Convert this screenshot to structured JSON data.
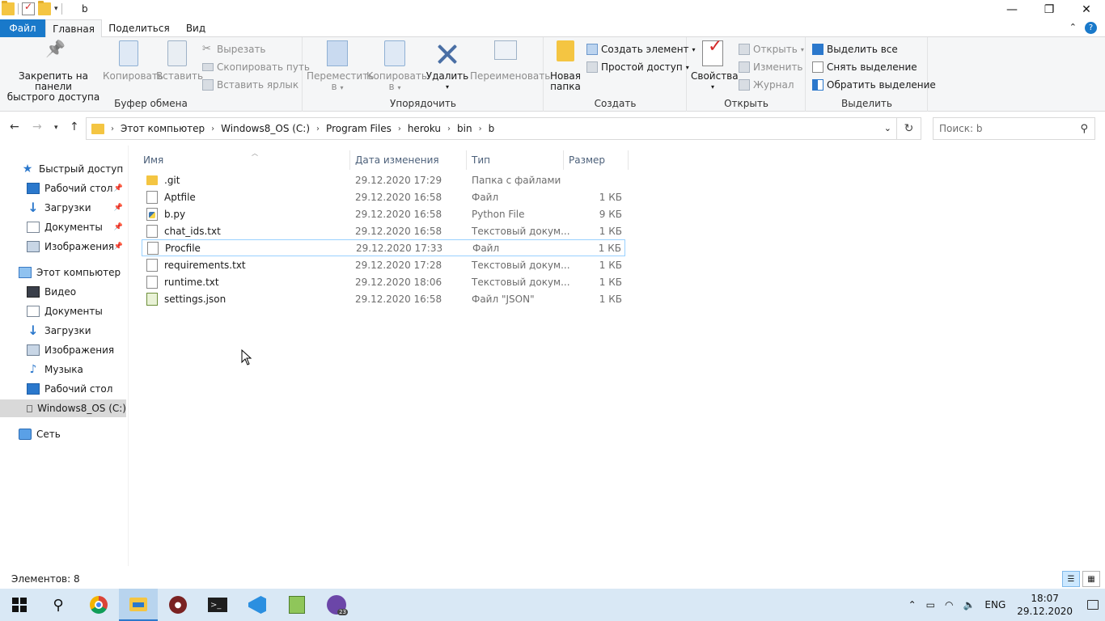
{
  "window": {
    "title": "b"
  },
  "window_controls": {
    "minimize": "—",
    "maximize": "❐",
    "close": "✕"
  },
  "ribbon_tabs": {
    "file": "Файл",
    "home": "Главная",
    "share": "Поделиться",
    "view": "Вид"
  },
  "ribbon": {
    "clipboard": {
      "label": "Буфер обмена",
      "pin_line1": "Закрепить на панели",
      "pin_line2": "быстрого доступа",
      "copy": "Копировать",
      "paste": "Вставить",
      "cut": "Вырезать",
      "copy_path": "Скопировать путь",
      "paste_shortcut": "Вставить ярлык"
    },
    "organize": {
      "label": "Упорядочить",
      "move_line1": "Переместить",
      "move_line2": "в",
      "copyto_line1": "Копировать",
      "copyto_line2": "в",
      "delete": "Удалить",
      "rename": "Переименовать"
    },
    "new": {
      "label": "Создать",
      "new_folder_line1": "Новая",
      "new_folder_line2": "папка",
      "new_item": "Создать элемент",
      "easy_access": "Простой доступ"
    },
    "open": {
      "label": "Открыть",
      "properties": "Свойства",
      "open": "Открыть",
      "edit": "Изменить",
      "history": "Журнал"
    },
    "select": {
      "label": "Выделить",
      "select_all": "Выделить все",
      "select_none": "Снять выделение",
      "invert": "Обратить выделение"
    }
  },
  "address": {
    "breadcrumbs": [
      "Этот компьютер",
      "Windows8_OS (C:)",
      "Program Files",
      "heroku",
      "bin",
      "b"
    ],
    "search_placeholder": "Поиск: b"
  },
  "sidebar": {
    "quick_access": "Быстрый доступ",
    "quick_items": [
      "Рабочий стол",
      "Загрузки",
      "Документы",
      "Изображения"
    ],
    "this_pc": "Этот компьютер",
    "pc_items": [
      "Видео",
      "Документы",
      "Загрузки",
      "Изображения",
      "Музыка",
      "Рабочий стол",
      "Windows8_OS (C:)"
    ],
    "network": "Сеть"
  },
  "columns": {
    "name": "Имя",
    "date": "Дата изменения",
    "type": "Тип",
    "size": "Размер"
  },
  "files": [
    {
      "name": ".git",
      "date": "29.12.2020 17:29",
      "type": "Папка с файлами",
      "size": "",
      "icon": "folder-icon"
    },
    {
      "name": "Aptfile",
      "date": "29.12.2020 16:58",
      "type": "Файл",
      "size": "1 КБ",
      "icon": "file-icon"
    },
    {
      "name": "b.py",
      "date": "29.12.2020 16:58",
      "type": "Python File",
      "size": "9 КБ",
      "icon": "python-file-icon"
    },
    {
      "name": "chat_ids.txt",
      "date": "29.12.2020 16:58",
      "type": "Текстовый докум...",
      "size": "1 КБ",
      "icon": "text-file-icon"
    },
    {
      "name": "Procfile",
      "date": "29.12.2020 17:33",
      "type": "Файл",
      "size": "1 КБ",
      "icon": "file-icon"
    },
    {
      "name": "requirements.txt",
      "date": "29.12.2020 17:28",
      "type": "Текстовый докум...",
      "size": "1 КБ",
      "icon": "text-file-icon"
    },
    {
      "name": "runtime.txt",
      "date": "29.12.2020 18:06",
      "type": "Текстовый докум...",
      "size": "1 КБ",
      "icon": "text-file-icon"
    },
    {
      "name": "settings.json",
      "date": "29.12.2020 16:58",
      "type": "Файл \"JSON\"",
      "size": "1 КБ",
      "icon": "json-file-icon"
    }
  ],
  "status": {
    "items": "Элементов: 8"
  },
  "taskbar": {
    "language": "ENG",
    "time": "18:07",
    "date": "29.12.2020"
  }
}
